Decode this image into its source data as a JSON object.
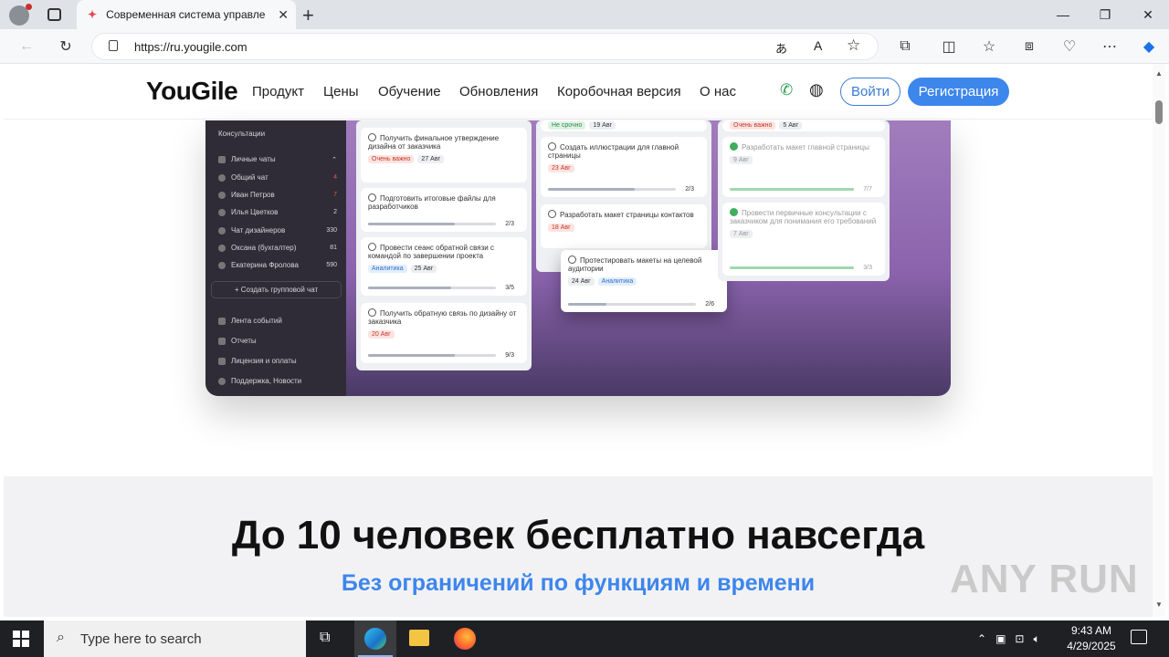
{
  "browser": {
    "tab_title": "Современная система управле",
    "url": "https://ru.yougile.com"
  },
  "site": {
    "logo": "YouGile",
    "nav": [
      "Продукт",
      "Цены",
      "Обучение",
      "Обновления",
      "Коробочная версия",
      "О нас"
    ],
    "login": "Войти",
    "register": "Регистрация"
  },
  "app": {
    "sidebar": [
      {
        "label": "Консультации",
        "count": ""
      },
      {
        "label": "Личные чаты",
        "count": ""
      },
      {
        "label": "Общий чат",
        "count": "4"
      },
      {
        "label": "Иван Петров",
        "count": "7"
      },
      {
        "label": "Илья Цветков",
        "count": "2"
      },
      {
        "label": "Чат дизайнеров",
        "count": "330"
      },
      {
        "label": "Оксана (бухгалтер)",
        "count": "81"
      },
      {
        "label": "Екатерина Фролова",
        "count": "590"
      },
      {
        "label": "+ Создать групповой чат",
        "count": ""
      },
      {
        "label": "Лента событий",
        "count": ""
      },
      {
        "label": "Отчеты",
        "count": ""
      },
      {
        "label": "Лицензия и оплаты",
        "count": ""
      },
      {
        "label": "Поддержка, Новости",
        "count": ""
      }
    ],
    "cards": {
      "c1": {
        "title": "Получить финальное утверждение дизайна от заказчика",
        "tag": "Очень важно",
        "date": "27 Авг"
      },
      "c2": {
        "title": "Подготовить итоговые файлы для разработчиков",
        "progress": "2/3"
      },
      "c3": {
        "title": "Провести сеанс обратной связи с командой по завершении проекта",
        "tag": "Аналитика",
        "date": "25 Авг",
        "progress": "3/5"
      },
      "c4": {
        "title": "Получить обратную связь по дизайну от заказчика",
        "date": "20 Авг",
        "progress": "9/3"
      },
      "c5": {
        "top": "Не срочно",
        "date": "19 Авг"
      },
      "c6": {
        "title": "Создать иллюстрации для главной страницы",
        "date": "23 Авг",
        "progress": "2/3"
      },
      "c7": {
        "title": "Разработать макет страницы контактов",
        "date": "18 Авг"
      },
      "c8": {
        "title": "Протестировать макеты на целевой аудитории",
        "date": "24 Авг",
        "tag": "Аналитика",
        "progress": "2/6"
      },
      "c9": {
        "top": "Очень важно",
        "date": "5 Авг"
      },
      "c10": {
        "title": "Разработать макет главной страницы",
        "date": "9 Авг",
        "progress": "7/7"
      },
      "c11": {
        "title": "Провести первичные консультации с заказчиком для понимания его требований",
        "date": "7 Авг",
        "progress": "3/3"
      }
    }
  },
  "pricing": {
    "heading": "До 10 человек бесплатно навсегда",
    "subheading": "Без ограничений по функциям и времени"
  },
  "watermark": "ANY RUN",
  "taskbar": {
    "search_placeholder": "Type here to search",
    "time": "9:43 AM",
    "date": "4/29/2025"
  }
}
